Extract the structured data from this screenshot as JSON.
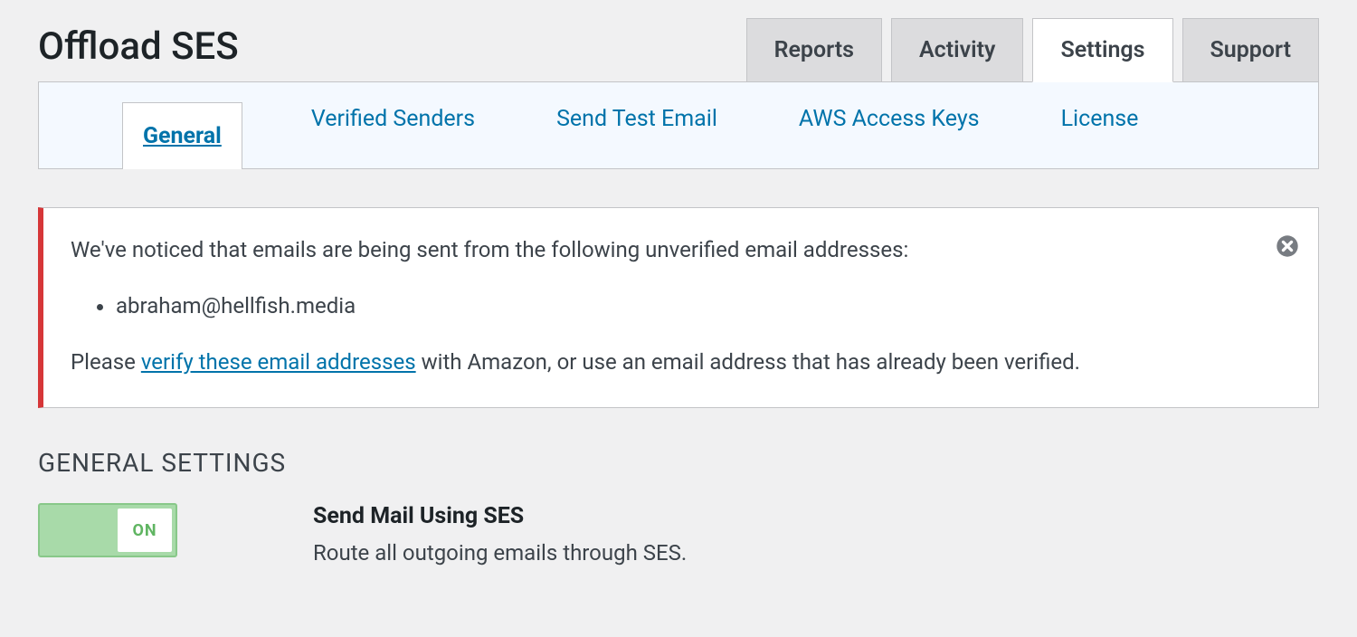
{
  "header": {
    "title": "Offload SES"
  },
  "main_tabs": {
    "reports": "Reports",
    "activity": "Activity",
    "settings": "Settings",
    "support": "Support"
  },
  "sub_tabs": {
    "general": "General",
    "verified_senders": "Verified Senders",
    "send_test_email": "Send Test Email",
    "aws_access_keys": "AWS Access Keys",
    "license": "License"
  },
  "notice": {
    "line1": "We've noticed that emails are being sent from the following unverified email addresses:",
    "emails": [
      "abraham@hellfish.media"
    ],
    "line2_prefix": "Please ",
    "line2_link": "verify these email addresses",
    "line2_suffix": " with Amazon, or use an email address that has already been verified."
  },
  "section": {
    "heading": "GENERAL SETTINGS"
  },
  "setting_send_mail": {
    "toggle_label": "ON",
    "title": "Send Mail Using SES",
    "description": "Route all outgoing emails through SES."
  }
}
